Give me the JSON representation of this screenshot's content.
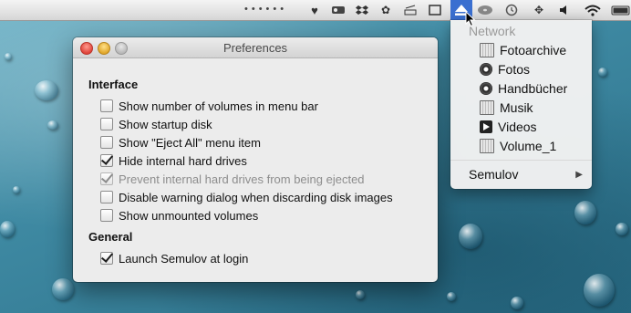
{
  "menubar": {
    "icons": [
      "overflow-dots",
      "heart-badge-icon",
      "drive-icon",
      "dropbox-icon",
      "paw-icon",
      "scanner-icon",
      "window-icon",
      "eject-icon",
      "disc-icon",
      "time-machine-icon",
      "move-icon",
      "volume-icon",
      "wifi-icon",
      "battery-icon"
    ]
  },
  "preferences": {
    "title": "Preferences",
    "interface_heading": "Interface",
    "options": [
      {
        "label": "Show number of volumes in menu bar",
        "checked": false,
        "enabled": true
      },
      {
        "label": "Show startup disk",
        "checked": false,
        "enabled": true
      },
      {
        "label": "Show \"Eject All\" menu item",
        "checked": false,
        "enabled": true
      },
      {
        "label": "Hide internal hard drives",
        "checked": true,
        "enabled": true
      },
      {
        "label": "Prevent internal hard drives from being ejected",
        "checked": true,
        "enabled": false
      },
      {
        "label": "Disable warning dialog when discarding disk images",
        "checked": false,
        "enabled": true
      },
      {
        "label": "Show unmounted volumes",
        "checked": false,
        "enabled": true
      }
    ],
    "general_heading": "General",
    "general_options": [
      {
        "label": "Launch Semulov at login",
        "checked": true,
        "enabled": true
      }
    ]
  },
  "menu": {
    "header": "Network",
    "items": [
      {
        "label": "Fotoarchive",
        "icon": "network-disk-icon"
      },
      {
        "label": "Fotos",
        "icon": "optical-disc-icon"
      },
      {
        "label": "Handbücher",
        "icon": "optical-disc-icon"
      },
      {
        "label": "Musik",
        "icon": "network-disk-icon"
      },
      {
        "label": "Videos",
        "icon": "video-disc-icon"
      },
      {
        "label": "Volume_1",
        "icon": "network-disk-icon"
      }
    ],
    "submenu_label": "Semulov"
  }
}
